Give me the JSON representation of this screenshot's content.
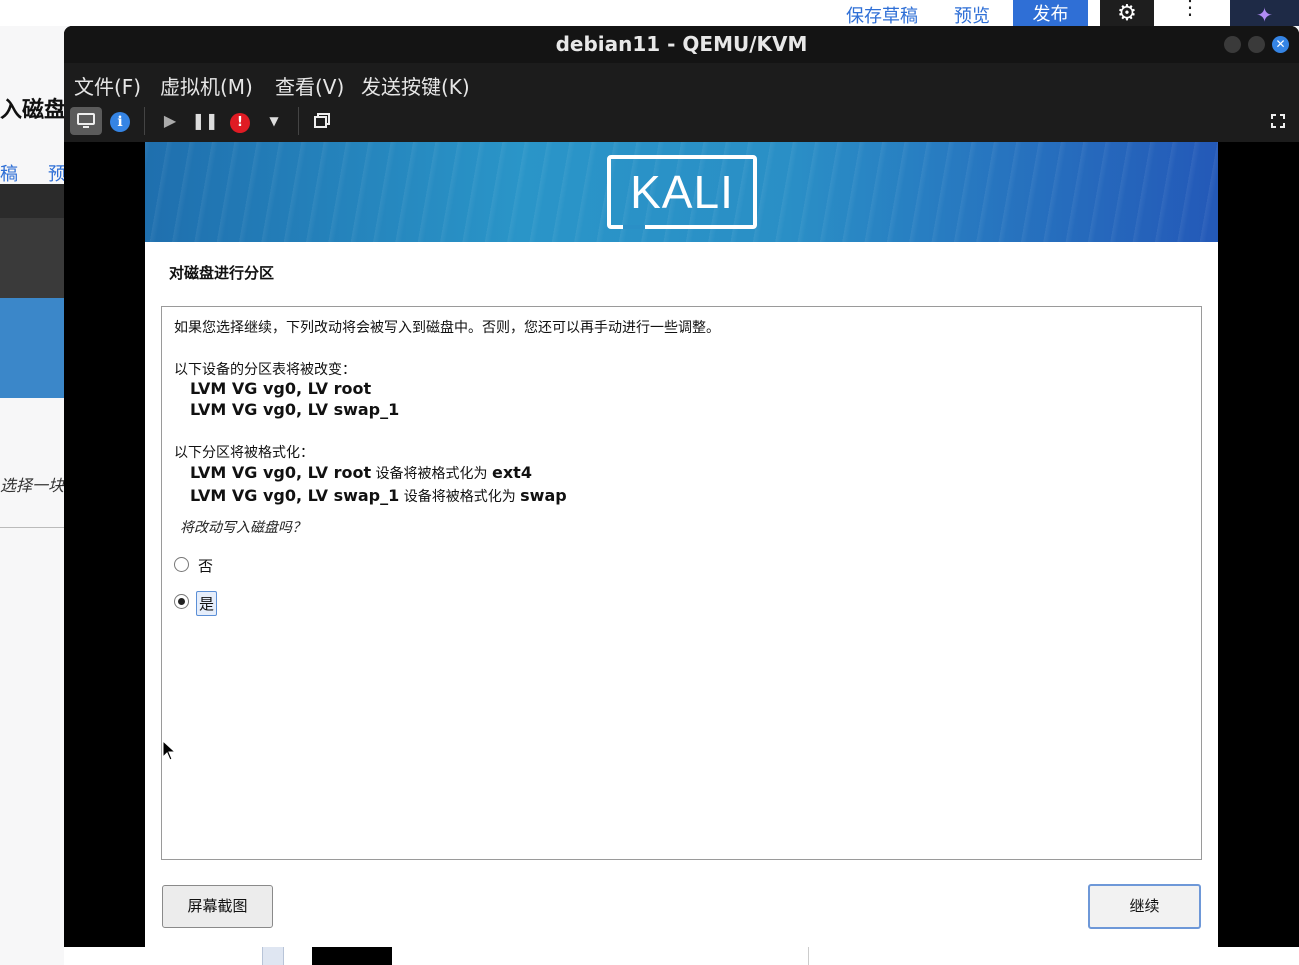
{
  "background": {
    "save_draft": "保存草稿",
    "preview": "预览",
    "publish": "发布",
    "page_title_fragment": "入磁盘",
    "tab_draft_fragment": "稿",
    "tab_preview_fragment": "预",
    "hint_fragment": "选择一块空"
  },
  "window": {
    "title": "debian11 - QEMU/KVM"
  },
  "menubar": {
    "file": "文件(F)",
    "vm": "虚拟机(M)",
    "view": "查看(V)",
    "send_key": "发送按键(K)"
  },
  "installer": {
    "logo_text": "KALI",
    "section_title": "对磁盘进行分区",
    "intro": "如果您选择继续，下列改动将会被写入到磁盘中。否则，您还可以再手动进行一些调整。",
    "partition_table_heading": "以下设备的分区表将被改变：",
    "partition_table_devices": [
      "LVM VG vg0, LV root",
      "LVM VG vg0, LV swap_1"
    ],
    "format_heading": "以下分区将被格式化：",
    "format_items": [
      {
        "device": "LVM VG vg0, LV root",
        "mid": " 设备将被格式化为 ",
        "fs": "ext4"
      },
      {
        "device": "LVM VG vg0, LV swap_1",
        "mid": " 设备将被格式化为 ",
        "fs": "swap"
      }
    ],
    "question": "将改动写入磁盘吗？",
    "options": [
      {
        "label": "否",
        "selected": false
      },
      {
        "label": "是",
        "selected": true
      }
    ],
    "screenshot_button": "屏幕截图",
    "continue_button": "继续"
  }
}
